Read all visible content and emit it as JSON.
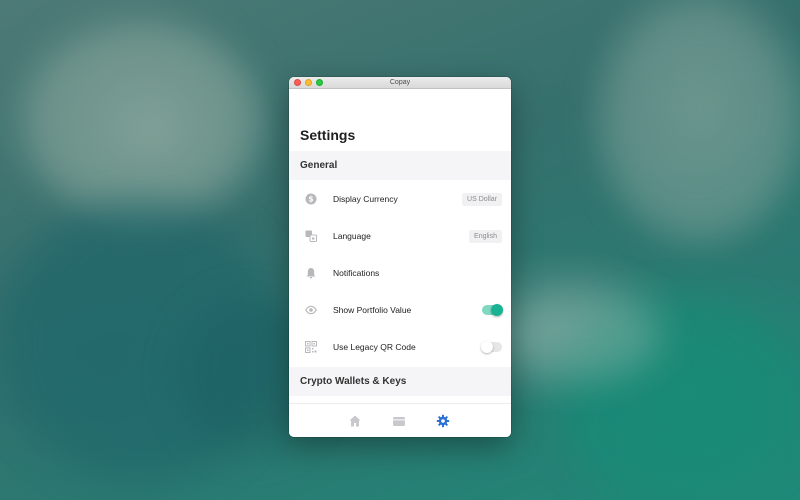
{
  "window": {
    "title": "Copay"
  },
  "page": {
    "title": "Settings"
  },
  "sections": {
    "general": "General",
    "crypto": "Crypto Wallets & Keys"
  },
  "items": [
    {
      "label": "Display Currency",
      "icon": "dollar-circle-icon",
      "value": "US Dollar"
    },
    {
      "label": "Language",
      "icon": "translate-icon",
      "value": "English"
    },
    {
      "label": "Notifications",
      "icon": "bell-icon"
    },
    {
      "label": "Show Portfolio Value",
      "icon": "eye-icon",
      "toggle": true
    },
    {
      "label": "Use Legacy QR Code",
      "icon": "qr-code-icon",
      "toggle": false
    }
  ],
  "tabs": [
    {
      "name": "home",
      "icon": "home-icon",
      "active": false
    },
    {
      "name": "cards",
      "icon": "card-icon",
      "active": false
    },
    {
      "name": "settings",
      "icon": "gear-icon",
      "active": true
    }
  ],
  "colors": {
    "accent": "#2b6fd6",
    "toggle_on": "#19b393",
    "icon_gray": "#b8b8bc",
    "section_bg": "#f5f5f7"
  }
}
